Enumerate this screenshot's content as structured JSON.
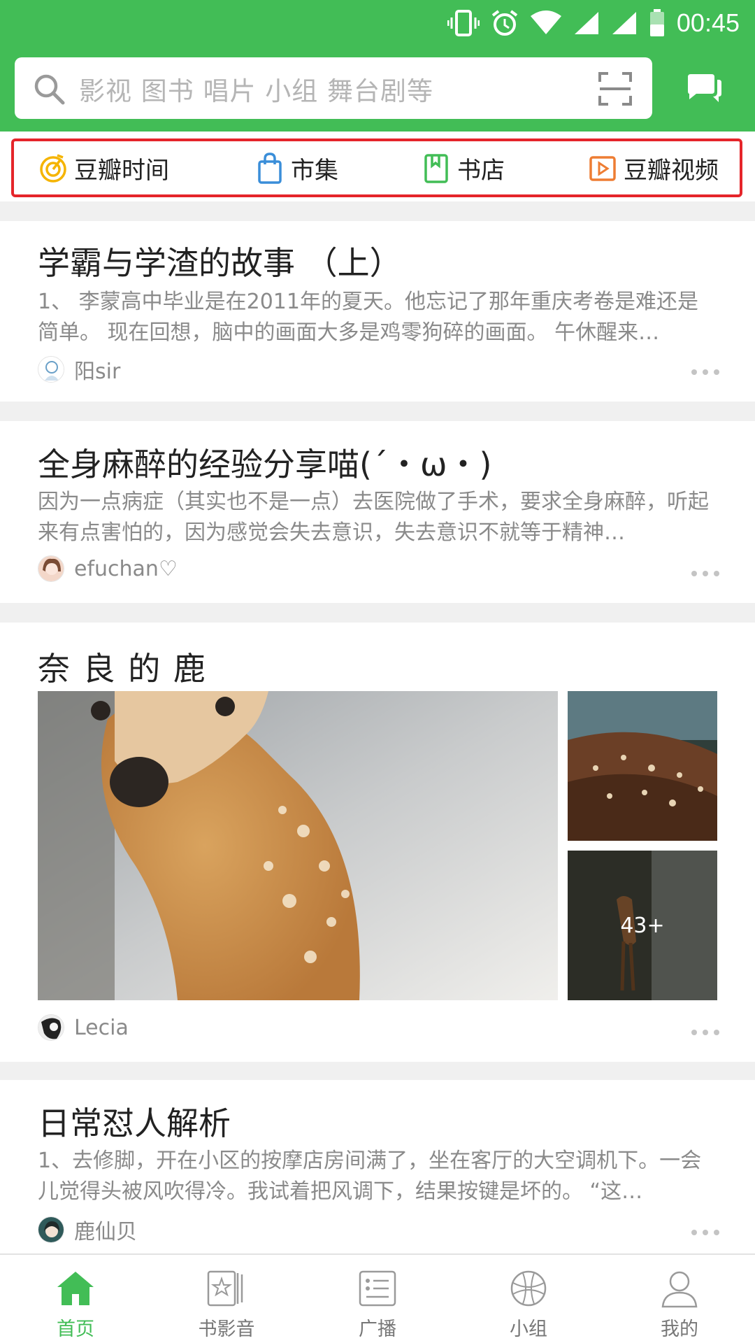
{
  "status_bar": {
    "time": "00:45"
  },
  "search": {
    "placeholder": "影视 图书 唱片 小组 舞台剧等"
  },
  "shortcuts": [
    {
      "label": "豆瓣时间",
      "icon": "timer-icon",
      "color": "#f5b400"
    },
    {
      "label": "市集",
      "icon": "shopping-bag-icon",
      "color": "#3a8ed9"
    },
    {
      "label": "书店",
      "icon": "book-icon",
      "color": "#42bd56"
    },
    {
      "label": "豆瓣视频",
      "icon": "play-icon",
      "color": "#ee7d33"
    }
  ],
  "feed": [
    {
      "title": "学霸与学渣的故事 （上）",
      "abstract": "1、 李蒙高中毕业是在2011年的夏天。他忘记了那年重庆考卷是难还是简单。 现在回想，脑中的画面大多是鸡零狗碎的画面。 午休醒来…",
      "author": "阳sir"
    },
    {
      "title": "全身麻醉的经验分享喵(´・ω・)",
      "abstract": "因为一点病症（其实也不是一点）去医院做了手术，要求全身麻醉，听起来有点害怕的，因为感觉会失去意识，失去意识不就等于精神…",
      "author": "efuchan♡"
    },
    {
      "title": "奈 良 的 鹿",
      "photo_count": "43+",
      "author": "Lecia"
    },
    {
      "title": "日常怼人解析",
      "abstract": "1、去修脚，开在小区的按摩店房间满了，坐在客厅的大空调机下。一会儿觉得头被风吹得冷。我试着把风调下，结果按键是坏的。 “这…",
      "author": "鹿仙贝"
    }
  ],
  "tabs": [
    {
      "label": "首页",
      "icon": "home-icon",
      "active": true
    },
    {
      "label": "书影音",
      "icon": "books-movies-music-icon",
      "active": false
    },
    {
      "label": "广播",
      "icon": "broadcast-icon",
      "active": false
    },
    {
      "label": "小组",
      "icon": "group-icon",
      "active": false
    },
    {
      "label": "我的",
      "icon": "profile-icon",
      "active": false
    }
  ],
  "colors": {
    "brand_green": "#42bd56",
    "highlight_red": "#e5252a"
  }
}
